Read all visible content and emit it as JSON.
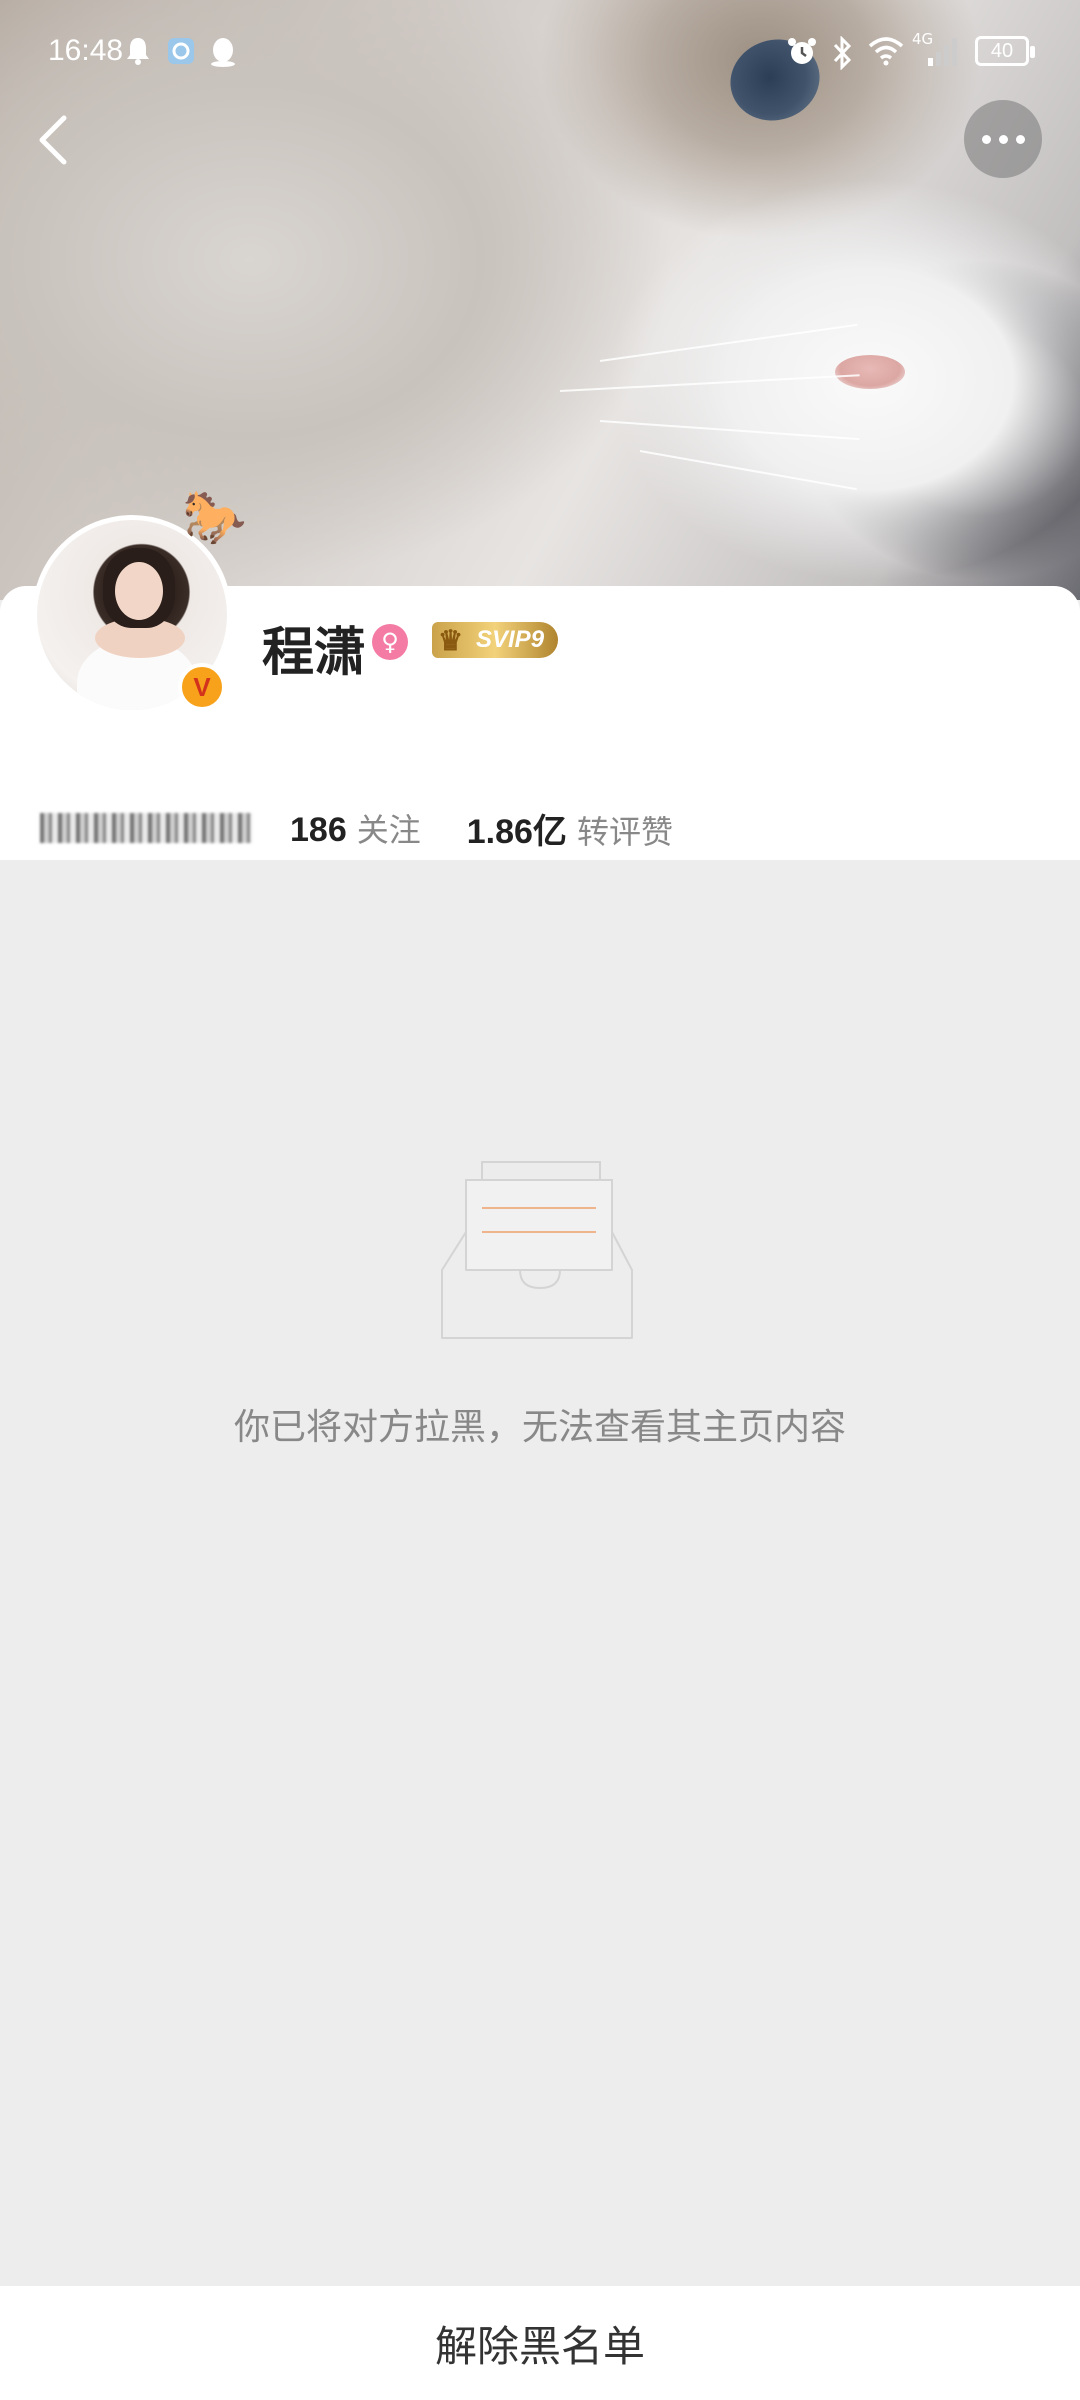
{
  "status_bar": {
    "time": "16:48",
    "network": "4G",
    "battery": "40",
    "icons": [
      "notification-bell-icon",
      "app-notification-icon",
      "qq-icon",
      "alarm-icon",
      "bluetooth-icon",
      "wifi-icon",
      "signal-icon",
      "battery-icon"
    ]
  },
  "profile": {
    "name": "程潇",
    "gender": "female",
    "vip_badge": "SVIP9",
    "verified": "V",
    "stats": [
      {
        "value": "186",
        "label": "关注"
      },
      {
        "value": "1.86亿",
        "label": "转评赞"
      }
    ]
  },
  "empty_state": {
    "message": "你已将对方拉黑，无法查看其主页内容"
  },
  "bottom_action": {
    "label": "解除黑名单"
  },
  "colors": {
    "page_bg": "#ededed",
    "gender_pink": "#f37ba4",
    "vip_gold": "#caa24b",
    "verified_orange": "#f7a21a"
  }
}
